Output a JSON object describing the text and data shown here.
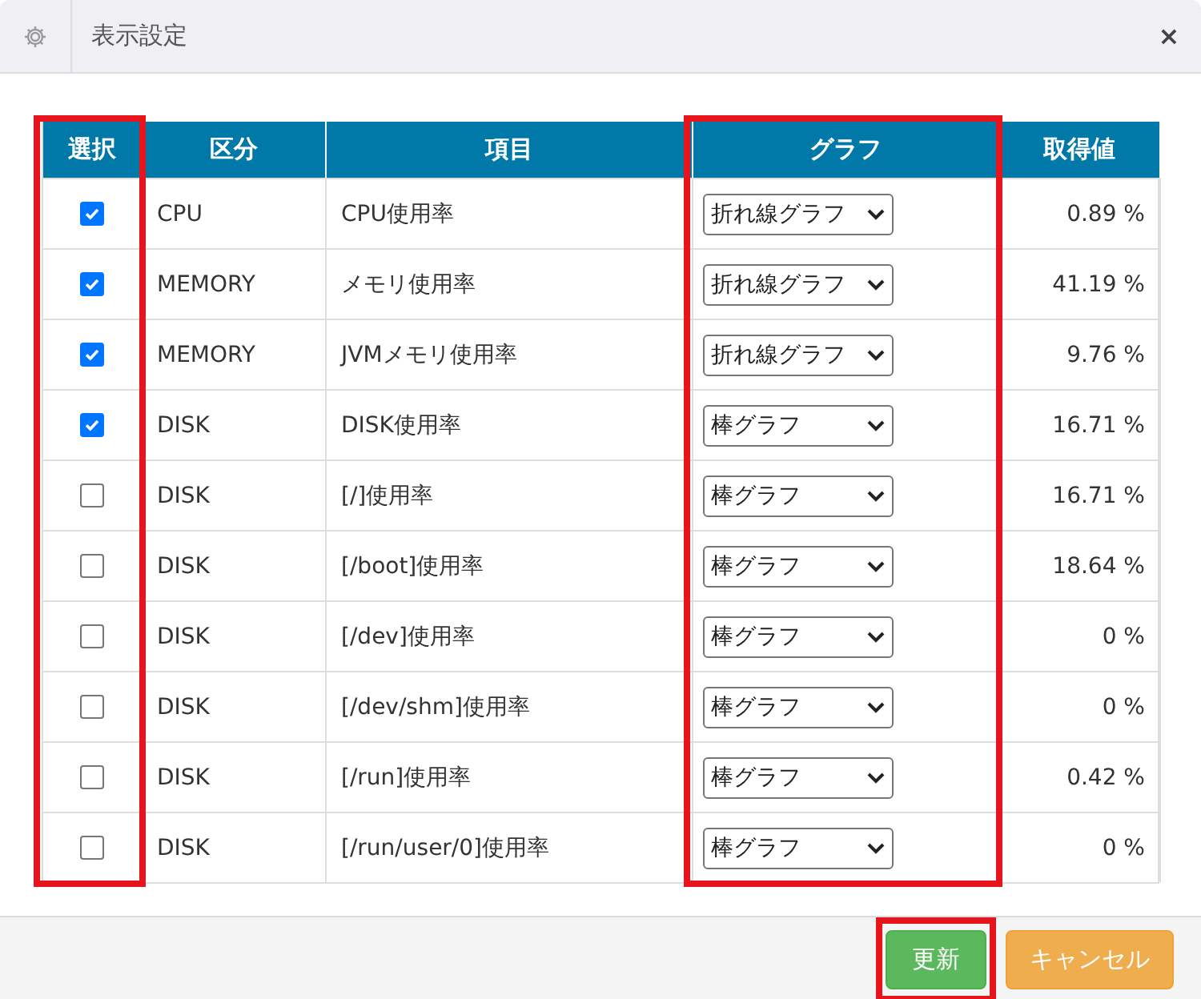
{
  "dialog": {
    "title": "表示設定",
    "close": "×"
  },
  "table": {
    "columns": [
      {
        "label": "選択",
        "highlighted": true
      },
      {
        "label": "区分",
        "highlighted": false
      },
      {
        "label": "項目",
        "highlighted": false
      },
      {
        "label": "グラフ",
        "highlighted": true
      },
      {
        "label": "取得値",
        "highlighted": false
      }
    ],
    "rows": [
      {
        "checked": true,
        "category": "CPU",
        "item": "CPU使用率",
        "graph": "折れ線グラフ",
        "value": "0.89 %"
      },
      {
        "checked": true,
        "category": "MEMORY",
        "item": "メモリ使用率",
        "graph": "折れ線グラフ",
        "value": "41.19 %"
      },
      {
        "checked": true,
        "category": "MEMORY",
        "item": "JVMメモリ使用率",
        "graph": "折れ線グラフ",
        "value": "9.76 %"
      },
      {
        "checked": true,
        "category": "DISK",
        "item": "DISK使用率",
        "graph": "棒グラフ",
        "value": "16.71 %"
      },
      {
        "checked": false,
        "category": "DISK",
        "item": "[/]使用率",
        "graph": "棒グラフ",
        "value": "16.71 %"
      },
      {
        "checked": false,
        "category": "DISK",
        "item": "[/boot]使用率",
        "graph": "棒グラフ",
        "value": "18.64 %"
      },
      {
        "checked": false,
        "category": "DISK",
        "item": "[/dev]使用率",
        "graph": "棒グラフ",
        "value": "0 %"
      },
      {
        "checked": false,
        "category": "DISK",
        "item": "[/dev/shm]使用率",
        "graph": "棒グラフ",
        "value": "0 %"
      },
      {
        "checked": false,
        "category": "DISK",
        "item": "[/run]使用率",
        "graph": "棒グラフ",
        "value": "0.42 %"
      },
      {
        "checked": false,
        "category": "DISK",
        "item": "[/run/user/0]使用率",
        "graph": "棒グラフ",
        "value": "0 %"
      }
    ]
  },
  "buttons": [
    {
      "label": "更新",
      "kind": "primary",
      "highlighted": true
    },
    {
      "label": "キャンセル",
      "kind": "cancel",
      "highlighted": false
    }
  ]
}
